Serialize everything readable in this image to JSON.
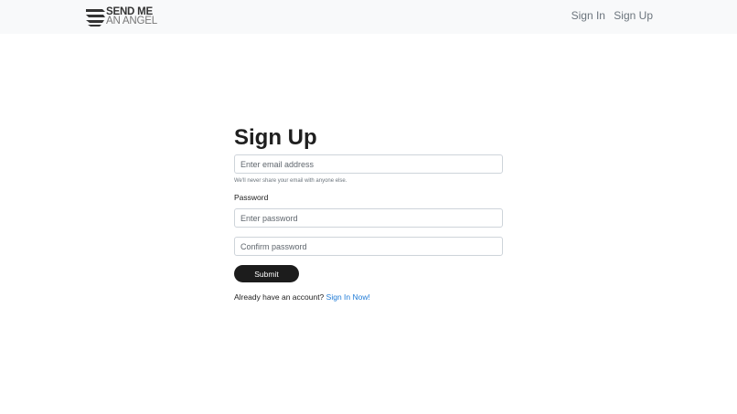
{
  "brand": {
    "line1": "SEND ME",
    "line2": "AN ANGEL",
    "logo_icon": "stripes-logo-icon"
  },
  "nav": {
    "sign_in": "Sign In",
    "sign_up": "Sign Up"
  },
  "form": {
    "title": "Sign Up",
    "email_placeholder": "Enter email address",
    "email_help": "We'll never share your email with anyone else.",
    "password_label": "Password",
    "password_placeholder": "Enter password",
    "confirm_placeholder": "Confirm password",
    "submit_label": "Submit",
    "already_text": "Already have an account?",
    "signin_link": "Sign In Now!"
  },
  "colors": {
    "navbar_bg": "#f8f9fa",
    "button_bg": "#1c1c1c",
    "link": "#1e7ad6"
  }
}
